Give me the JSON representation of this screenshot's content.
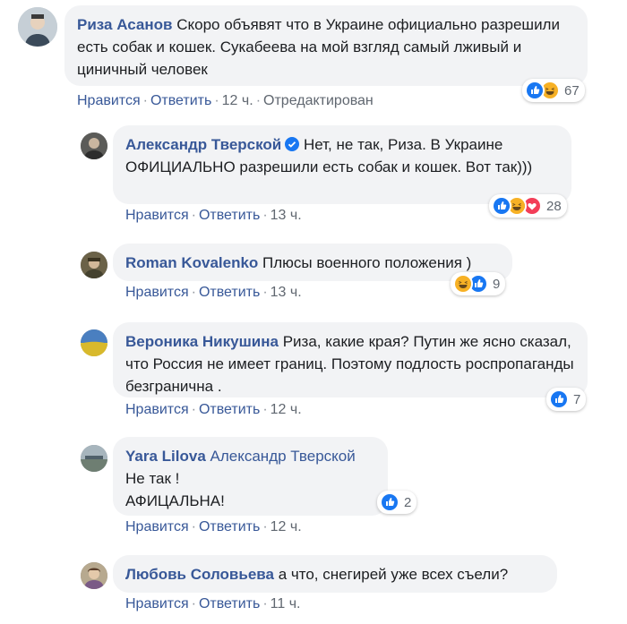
{
  "comments": [
    {
      "author": "Риза Асанов",
      "text": "Скоро объявят что в Украине официально разрешили есть собак и кошек. Сукабеева на мой взгляд самый лживый и циничный человек",
      "like": "Нравится",
      "reply": "Ответить",
      "time": "12 ч.",
      "edited": "Отредактирован",
      "reaction_icons": [
        "like-icon",
        "haha-icon"
      ],
      "reaction_count": "67"
    },
    {
      "author": "Александр Тверской",
      "verified": true,
      "text": "Нет, не так, Риза. В Украине ОФИЦИАЛЬНО разрешили есть собак и кошек. Вот так)))",
      "like": "Нравится",
      "reply": "Ответить",
      "time": "13 ч.",
      "reaction_icons": [
        "like-icon",
        "haha-icon",
        "love-icon"
      ],
      "reaction_count": "28"
    },
    {
      "author": "Roman Kovalenko",
      "text": "Плюсы военного положения )",
      "like": "Нравится",
      "reply": "Ответить",
      "time": "13 ч.",
      "reaction_icons": [
        "haha-icon",
        "like-icon"
      ],
      "reaction_count": "9"
    },
    {
      "author": "Вероника Никушина",
      "text": "Риза, какие края? Путин же ясно сказал, что Россия не имеет границ. Поэтому подлость роспропаганды безгранична .",
      "like": "Нравится",
      "reply": "Ответить",
      "time": "12 ч.",
      "reaction_icons": [
        "like-icon"
      ],
      "reaction_count": "7"
    },
    {
      "author": "Yara Lilova",
      "mention": "Александр Тверской",
      "text_line1": "Не так !",
      "text_line2": "АФИЦАЛЬНА!",
      "like": "Нравится",
      "reply": "Ответить",
      "time": "12 ч.",
      "reaction_icons": [
        "like-icon"
      ],
      "reaction_count": "2"
    },
    {
      "author": "Любовь Соловьева",
      "text": "а что, снегирей уже всех съели?",
      "like": "Нравится",
      "reply": "Ответить",
      "time": "11 ч."
    }
  ],
  "colors": {
    "link": "#385898",
    "bubble": "#f2f3f5",
    "like": "#1877f2",
    "haha": "#f7b125",
    "love": "#f33e58"
  }
}
